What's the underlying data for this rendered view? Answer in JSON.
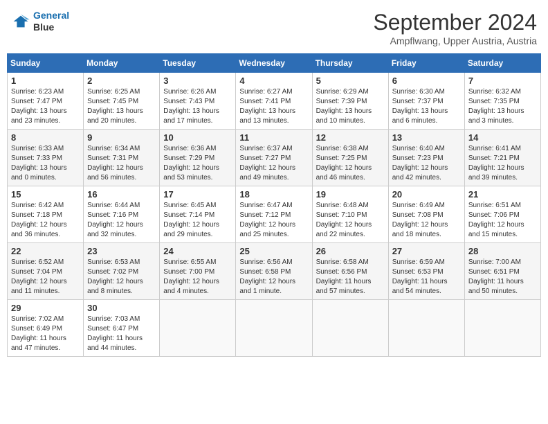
{
  "header": {
    "logo_line1": "General",
    "logo_line2": "Blue",
    "month_title": "September 2024",
    "location": "Ampflwang, Upper Austria, Austria"
  },
  "weekdays": [
    "Sunday",
    "Monday",
    "Tuesday",
    "Wednesday",
    "Thursday",
    "Friday",
    "Saturday"
  ],
  "weeks": [
    [
      {
        "day": "1",
        "sunrise": "6:23 AM",
        "sunset": "7:47 PM",
        "daylight": "13 hours and 23 minutes."
      },
      {
        "day": "2",
        "sunrise": "6:25 AM",
        "sunset": "7:45 PM",
        "daylight": "13 hours and 20 minutes."
      },
      {
        "day": "3",
        "sunrise": "6:26 AM",
        "sunset": "7:43 PM",
        "daylight": "13 hours and 17 minutes."
      },
      {
        "day": "4",
        "sunrise": "6:27 AM",
        "sunset": "7:41 PM",
        "daylight": "13 hours and 13 minutes."
      },
      {
        "day": "5",
        "sunrise": "6:29 AM",
        "sunset": "7:39 PM",
        "daylight": "13 hours and 10 minutes."
      },
      {
        "day": "6",
        "sunrise": "6:30 AM",
        "sunset": "7:37 PM",
        "daylight": "13 hours and 6 minutes."
      },
      {
        "day": "7",
        "sunrise": "6:32 AM",
        "sunset": "7:35 PM",
        "daylight": "13 hours and 3 minutes."
      }
    ],
    [
      {
        "day": "8",
        "sunrise": "6:33 AM",
        "sunset": "7:33 PM",
        "daylight": "13 hours and 0 minutes."
      },
      {
        "day": "9",
        "sunrise": "6:34 AM",
        "sunset": "7:31 PM",
        "daylight": "12 hours and 56 minutes."
      },
      {
        "day": "10",
        "sunrise": "6:36 AM",
        "sunset": "7:29 PM",
        "daylight": "12 hours and 53 minutes."
      },
      {
        "day": "11",
        "sunrise": "6:37 AM",
        "sunset": "7:27 PM",
        "daylight": "12 hours and 49 minutes."
      },
      {
        "day": "12",
        "sunrise": "6:38 AM",
        "sunset": "7:25 PM",
        "daylight": "12 hours and 46 minutes."
      },
      {
        "day": "13",
        "sunrise": "6:40 AM",
        "sunset": "7:23 PM",
        "daylight": "12 hours and 42 minutes."
      },
      {
        "day": "14",
        "sunrise": "6:41 AM",
        "sunset": "7:21 PM",
        "daylight": "12 hours and 39 minutes."
      }
    ],
    [
      {
        "day": "15",
        "sunrise": "6:42 AM",
        "sunset": "7:18 PM",
        "daylight": "12 hours and 36 minutes."
      },
      {
        "day": "16",
        "sunrise": "6:44 AM",
        "sunset": "7:16 PM",
        "daylight": "12 hours and 32 minutes."
      },
      {
        "day": "17",
        "sunrise": "6:45 AM",
        "sunset": "7:14 PM",
        "daylight": "12 hours and 29 minutes."
      },
      {
        "day": "18",
        "sunrise": "6:47 AM",
        "sunset": "7:12 PM",
        "daylight": "12 hours and 25 minutes."
      },
      {
        "day": "19",
        "sunrise": "6:48 AM",
        "sunset": "7:10 PM",
        "daylight": "12 hours and 22 minutes."
      },
      {
        "day": "20",
        "sunrise": "6:49 AM",
        "sunset": "7:08 PM",
        "daylight": "12 hours and 18 minutes."
      },
      {
        "day": "21",
        "sunrise": "6:51 AM",
        "sunset": "7:06 PM",
        "daylight": "12 hours and 15 minutes."
      }
    ],
    [
      {
        "day": "22",
        "sunrise": "6:52 AM",
        "sunset": "7:04 PM",
        "daylight": "12 hours and 11 minutes."
      },
      {
        "day": "23",
        "sunrise": "6:53 AM",
        "sunset": "7:02 PM",
        "daylight": "12 hours and 8 minutes."
      },
      {
        "day": "24",
        "sunrise": "6:55 AM",
        "sunset": "7:00 PM",
        "daylight": "12 hours and 4 minutes."
      },
      {
        "day": "25",
        "sunrise": "6:56 AM",
        "sunset": "6:58 PM",
        "daylight": "12 hours and 1 minute."
      },
      {
        "day": "26",
        "sunrise": "6:58 AM",
        "sunset": "6:56 PM",
        "daylight": "11 hours and 57 minutes."
      },
      {
        "day": "27",
        "sunrise": "6:59 AM",
        "sunset": "6:53 PM",
        "daylight": "11 hours and 54 minutes."
      },
      {
        "day": "28",
        "sunrise": "7:00 AM",
        "sunset": "6:51 PM",
        "daylight": "11 hours and 50 minutes."
      }
    ],
    [
      {
        "day": "29",
        "sunrise": "7:02 AM",
        "sunset": "6:49 PM",
        "daylight": "11 hours and 47 minutes."
      },
      {
        "day": "30",
        "sunrise": "7:03 AM",
        "sunset": "6:47 PM",
        "daylight": "11 hours and 44 minutes."
      },
      null,
      null,
      null,
      null,
      null
    ]
  ]
}
